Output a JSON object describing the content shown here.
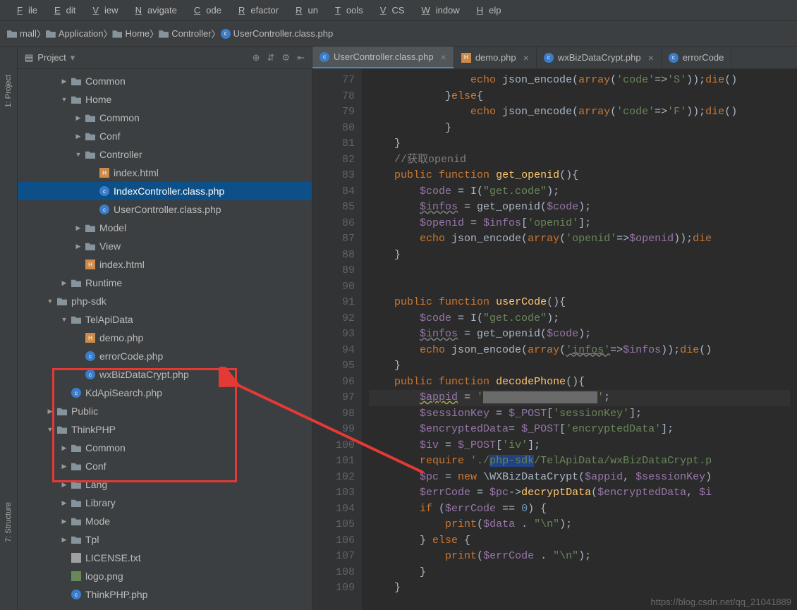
{
  "menu": [
    "File",
    "Edit",
    "View",
    "Navigate",
    "Code",
    "Refactor",
    "Run",
    "Tools",
    "VCS",
    "Window",
    "Help"
  ],
  "breadcrumbs": [
    {
      "icon": "folder",
      "label": "mall"
    },
    {
      "icon": "folder",
      "label": "Application"
    },
    {
      "icon": "folder",
      "label": "Home"
    },
    {
      "icon": "folder",
      "label": "Controller"
    },
    {
      "icon": "php",
      "label": "UserController.class.php"
    }
  ],
  "sidebar_tabs": [
    "1: Project",
    "7: Structure"
  ],
  "panel_title": "Project",
  "tree": [
    {
      "indent": 3,
      "arrow": "right",
      "icon": "folder",
      "label": "Common"
    },
    {
      "indent": 3,
      "arrow": "down",
      "icon": "folder",
      "label": "Home"
    },
    {
      "indent": 4,
      "arrow": "right",
      "icon": "folder",
      "label": "Common"
    },
    {
      "indent": 4,
      "arrow": "right",
      "icon": "folder",
      "label": "Conf"
    },
    {
      "indent": 4,
      "arrow": "down",
      "icon": "folder",
      "label": "Controller"
    },
    {
      "indent": 5,
      "arrow": "",
      "icon": "html",
      "label": "index.html"
    },
    {
      "indent": 5,
      "arrow": "",
      "icon": "php",
      "label": "IndexController.class.php",
      "selected": true
    },
    {
      "indent": 5,
      "arrow": "",
      "icon": "php",
      "label": "UserController.class.php"
    },
    {
      "indent": 4,
      "arrow": "right",
      "icon": "folder",
      "label": "Model"
    },
    {
      "indent": 4,
      "arrow": "right",
      "icon": "folder",
      "label": "View"
    },
    {
      "indent": 4,
      "arrow": "",
      "icon": "html",
      "label": "index.html"
    },
    {
      "indent": 3,
      "arrow": "right",
      "icon": "folder",
      "label": "Runtime"
    },
    {
      "indent": 2,
      "arrow": "down",
      "icon": "folder",
      "label": "php-sdk"
    },
    {
      "indent": 3,
      "arrow": "down",
      "icon": "folder",
      "label": "TelApiData"
    },
    {
      "indent": 4,
      "arrow": "",
      "icon": "html",
      "label": "demo.php"
    },
    {
      "indent": 4,
      "arrow": "",
      "icon": "php",
      "label": "errorCode.php"
    },
    {
      "indent": 4,
      "arrow": "",
      "icon": "php",
      "label": "wxBizDataCrypt.php"
    },
    {
      "indent": 3,
      "arrow": "",
      "icon": "php",
      "label": "KdApiSearch.php"
    },
    {
      "indent": 2,
      "arrow": "right",
      "icon": "folder",
      "label": "Public"
    },
    {
      "indent": 2,
      "arrow": "down",
      "icon": "folder",
      "label": "ThinkPHP"
    },
    {
      "indent": 3,
      "arrow": "right",
      "icon": "folder",
      "label": "Common"
    },
    {
      "indent": 3,
      "arrow": "right",
      "icon": "folder",
      "label": "Conf"
    },
    {
      "indent": 3,
      "arrow": "right",
      "icon": "folder",
      "label": "Lang"
    },
    {
      "indent": 3,
      "arrow": "right",
      "icon": "folder",
      "label": "Library"
    },
    {
      "indent": 3,
      "arrow": "right",
      "icon": "folder",
      "label": "Mode"
    },
    {
      "indent": 3,
      "arrow": "right",
      "icon": "folder",
      "label": "Tpl"
    },
    {
      "indent": 3,
      "arrow": "",
      "icon": "txt",
      "label": "LICENSE.txt"
    },
    {
      "indent": 3,
      "arrow": "",
      "icon": "img",
      "label": "logo.png"
    },
    {
      "indent": 3,
      "arrow": "",
      "icon": "php",
      "label": "ThinkPHP.php"
    }
  ],
  "editor_tabs": [
    {
      "icon": "php",
      "label": "UserController.class.php",
      "active": true
    },
    {
      "icon": "html",
      "label": "demo.php",
      "active": false
    },
    {
      "icon": "php",
      "label": "wxBizDataCrypt.php",
      "active": false
    },
    {
      "icon": "php",
      "label": "errorCode",
      "active": false,
      "noclose": true
    }
  ],
  "line_start": 77,
  "line_end": 109,
  "watermark": "https://blog.csdn.net/qq_21041889",
  "code_lines": [
    {
      "n": 77,
      "html": "                <span class='kw'>echo</span> json_encode(<span class='kw'>array</span>(<span class='str'>'code'</span>=&gt;<span class='str'>'S'</span>));<span class='kw'>die</span>()"
    },
    {
      "n": 78,
      "html": "            }<span class='kw'>else</span>{"
    },
    {
      "n": 79,
      "html": "                <span class='kw'>echo</span> json_encode(<span class='kw'>array</span>(<span class='str'>'code'</span>=&gt;<span class='str'>'F'</span>));<span class='kw'>die</span>()"
    },
    {
      "n": 80,
      "html": "            }"
    },
    {
      "n": 81,
      "html": "    }"
    },
    {
      "n": 82,
      "html": "    <span class='com'>//获取openid</span>"
    },
    {
      "n": 83,
      "html": "    <span class='kw'>public function</span> <span class='fn'>get_openid</span>(){"
    },
    {
      "n": 84,
      "html": "        <span class='var'>$code</span> = I(<span class='str'>\"get.code\"</span>);"
    },
    {
      "n": 85,
      "html": "        <span class='var wavy'>$infos</span> = get_openid(<span class='var'>$code</span>);"
    },
    {
      "n": 86,
      "html": "        <span class='var'>$openid</span> = <span class='var'>$infos</span>[<span class='str'>'openid'</span>];"
    },
    {
      "n": 87,
      "html": "        <span class='kw'>echo</span> json_encode(<span class='kw'>array</span>(<span class='str'>'openid'</span>=&gt;<span class='var'>$openid</span>));<span class='kw'>die</span>"
    },
    {
      "n": 88,
      "html": "    }"
    },
    {
      "n": 89,
      "html": ""
    },
    {
      "n": 90,
      "html": ""
    },
    {
      "n": 91,
      "html": "    <span class='kw'>public function</span> <span class='fn'>userCode</span>(){"
    },
    {
      "n": 92,
      "html": "        <span class='var'>$code</span> = I(<span class='str'>\"get.code\"</span>);"
    },
    {
      "n": 93,
      "html": "        <span class='var wavy'>$infos</span> = get_openid(<span class='var'>$code</span>);"
    },
    {
      "n": 94,
      "html": "        <span class='kw'>echo</span> json_encode(<span class='kw'>array</span>(<span class='str wavy'>'<u>infos</u>'</span>=&gt;<span class='var'>$infos</span>));<span class='kw'>die</span>()"
    },
    {
      "n": 95,
      "html": "    }"
    },
    {
      "n": 96,
      "html": "    <span class='kw'>public function</span> <span class='fn'>decodePhone</span>(){"
    },
    {
      "n": 97,
      "hl": true,
      "bulb": true,
      "html": "        <span class='var warn-underline'>$appid</span> = <span class='str'>'</span><span class='redact'>wxxxxxxxxxxxxxxxxx</span><span class='str'>'</span>;"
    },
    {
      "n": 98,
      "html": "        <span class='var'>$sessionKey</span> = <span class='var'>$_POST</span>[<span class='str'>'sessionKey'</span>];"
    },
    {
      "n": 99,
      "html": "        <span class='var'>$encryptedData</span>= <span class='var'>$_POST</span>[<span class='str'>'encryptedData'</span>];"
    },
    {
      "n": 100,
      "html": "        <span class='var'>$iv</span> = <span class='var'>$_POST</span>[<span class='str'>'iv'</span>];"
    },
    {
      "n": 101,
      "html": "        <span class='kw'>require</span> <span class='str'>'./</span><span class='hl-bg' style='color:#6a8759'>php-sdk</span><span class='str'>/TelApiData/wxBizDataCrypt.p</span>"
    },
    {
      "n": 102,
      "html": "        <span class='var'>$pc</span> = <span class='kw'>new</span> \\WXBizDataCrypt(<span class='var'>$appid</span>, <span class='var'>$sessionKey</span>)"
    },
    {
      "n": 103,
      "html": "        <span class='var'>$errCode</span> = <span class='var'>$pc</span>-&gt;<span class='fn'>decryptData</span>(<span class='var'>$encryptedData</span>, <span class='var'>$i</span>"
    },
    {
      "n": 104,
      "html": "        <span class='kw'>if</span> (<span class='var'>$errCode</span> == <span class='num'>0</span>) {"
    },
    {
      "n": 105,
      "html": "            <span class='kw'>print</span>(<span class='var'>$data</span> . <span class='str'>\"\\n\"</span>);"
    },
    {
      "n": 106,
      "html": "        } <span class='kw'>else</span> {"
    },
    {
      "n": 107,
      "html": "            <span class='kw'>print</span>(<span class='var'>$errCode</span> . <span class='str'>\"\\n\"</span>);"
    },
    {
      "n": 108,
      "html": "        }"
    },
    {
      "n": 109,
      "html": "    }"
    }
  ]
}
